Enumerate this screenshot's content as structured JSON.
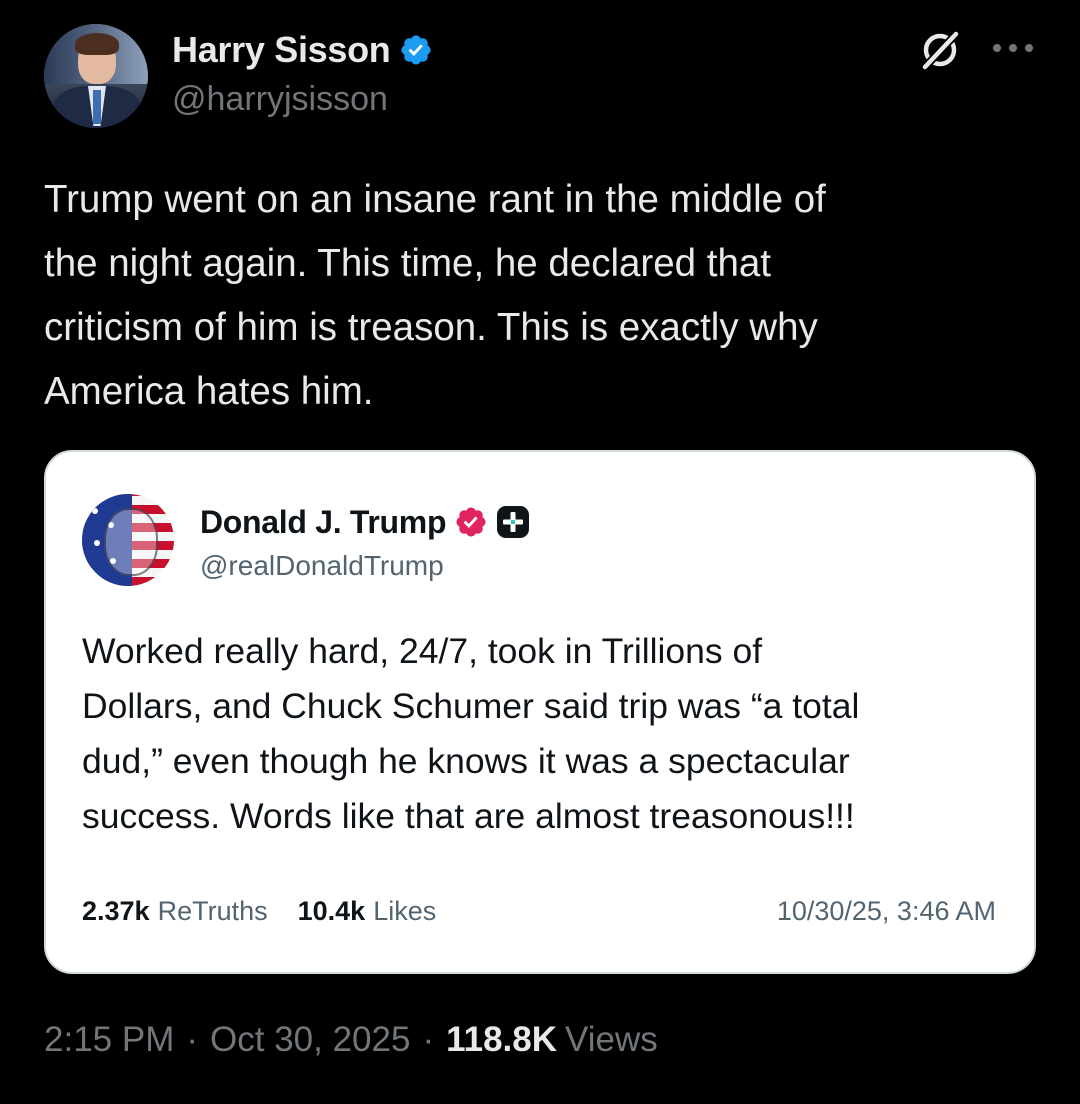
{
  "author": {
    "display_name": "Harry Sisson",
    "handle": "@harryjsisson",
    "verified_color": "#1d9bf0"
  },
  "header_actions": {
    "grok_icon": "grok-icon",
    "more_icon": "more-options-icon"
  },
  "tweet": {
    "text": "Trump went on an insane rant in the middle of\nthe night again. This time, he declared that\ncriticism of him is treason. This is exactly why\nAmerica hates him."
  },
  "quoted_post": {
    "display_name": "Donald J. Trump",
    "handle": "@realDonaldTrump",
    "verified_color": "#e0245e",
    "text": "Worked really hard, 24/7, took in Trillions of\nDollars, and Chuck Schumer said trip was “a total\ndud,” even though he knows it was a spectacular\nsuccess. Words like that are almost treasonous!!!",
    "retruths_count": "2.37k",
    "retruths_label": "ReTruths",
    "likes_count": "10.4k",
    "likes_label": "Likes",
    "timestamp": "10/30/25, 3:46 AM"
  },
  "meta": {
    "time": "2:15 PM",
    "separator": "·",
    "date": "Oct 30, 2025",
    "views_count": "118.8K",
    "views_label": "Views"
  }
}
